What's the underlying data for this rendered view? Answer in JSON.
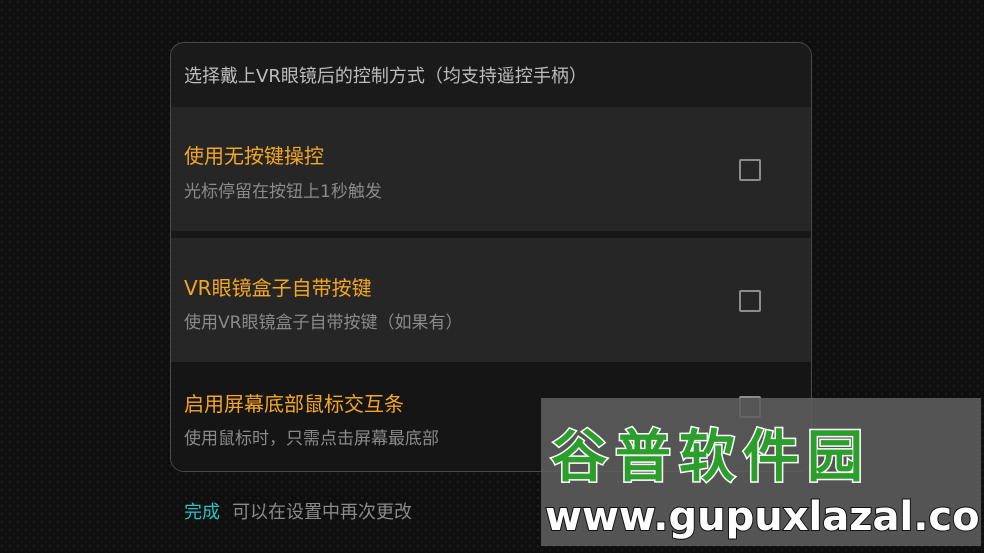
{
  "dialog": {
    "header": "选择戴上VR眼镜后的控制方式（均支持遥控手柄）",
    "options": [
      {
        "title": "使用无按键操控",
        "desc": "光标停留在按钮上1秒触发",
        "checked": false
      },
      {
        "title": "VR眼镜盒子自带按键",
        "desc": "使用VR眼镜盒子自带按键（如果有）",
        "checked": false
      },
      {
        "title": "启用屏幕底部鼠标交互条",
        "desc": "使用鼠标时，只需点击屏幕最底部",
        "checked": false
      }
    ]
  },
  "footer": {
    "done_label": "完成",
    "note": "可以在设置中再次更改"
  },
  "watermark": {
    "logo": "谷普软件园",
    "url": "www.gupuxlazal.com"
  },
  "colors": {
    "accent": "#f5a623",
    "link": "#28c3c3",
    "background": "#0e0e0e",
    "watermark_green": "#2b9e2b"
  },
  "icons": {
    "checkbox": "checkbox-unchecked-icon"
  }
}
